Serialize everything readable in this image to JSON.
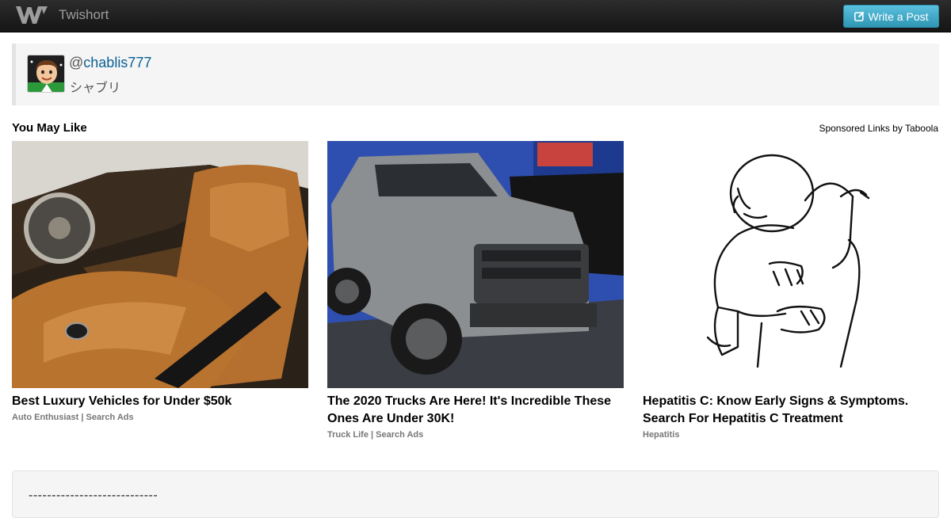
{
  "navbar": {
    "brand_name": "Twishort",
    "write_button_label": "Write a Post"
  },
  "author": {
    "at_symbol": "@",
    "handle": "chablis777",
    "display_name": "シャブリ"
  },
  "recommendations": {
    "title": "You May Like",
    "sponsored_label": "Sponsored Links by Taboola",
    "cards": [
      {
        "headline": "Best Luxury Vehicles for Under $50k",
        "source": "Auto Enthusiast | Search Ads"
      },
      {
        "headline": "The 2020 Trucks Are Here! It's Incredible These Ones Are Under 30K!",
        "source": "Truck Life | Search Ads"
      },
      {
        "headline": "Hepatitis C: Know Early Signs & Symptoms. Search For Hepatitis C Treatment",
        "source": "Hepatitis"
      }
    ]
  },
  "post": {
    "text": "----------------------------"
  },
  "colors": {
    "navbar_dark": "#1b1b1b",
    "button_accent": "#49afcd",
    "link": "#0b5f93",
    "panel_bg": "#f5f5f5"
  }
}
